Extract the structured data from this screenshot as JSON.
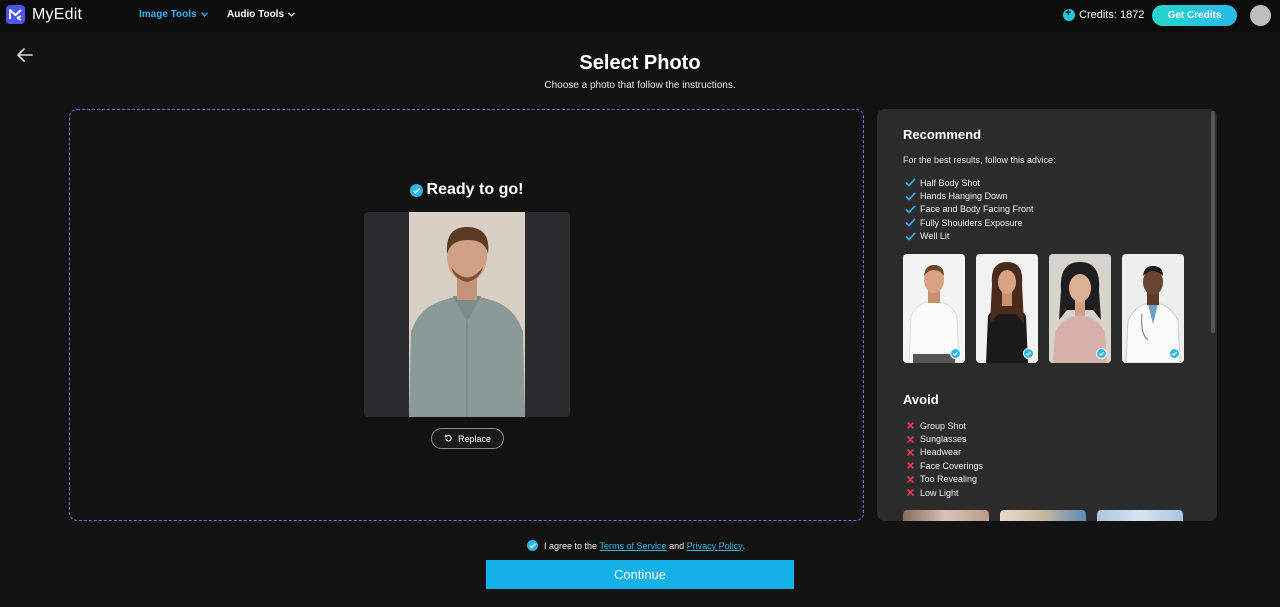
{
  "header": {
    "app_name": "MyEdit",
    "nav": [
      {
        "label": "Image Tools",
        "active": true
      },
      {
        "label": "Audio Tools",
        "active": false
      }
    ],
    "credits_label": "Credits: 1872",
    "get_credits_label": "Get Credits",
    "accent_color": "#2bb6ea"
  },
  "page": {
    "title": "Select Photo",
    "subtitle": "Choose a photo that follow the instructions."
  },
  "upload": {
    "status": "Ready to go!",
    "replace_label": "Replace"
  },
  "recommend": {
    "heading": "Recommend",
    "intro": "For the best results, follow this advice:",
    "items": [
      "Half Body Shot",
      "Hands Hanging Down",
      "Face and Body Facing Front",
      "Fully Shoulders Exposure",
      "Well Lit"
    ]
  },
  "avoid": {
    "heading": "Avoid",
    "items": [
      "Group Shot",
      "Sunglasses",
      "Headwear",
      "Face Coverings",
      "Too Revealing",
      "Low Light"
    ]
  },
  "footer": {
    "agree_prefix": "I agree to the ",
    "terms_label": "Terms of Service",
    "and_text": " and ",
    "privacy_label": "Privacy Policy",
    "period": ".",
    "continue_label": "Continue"
  }
}
